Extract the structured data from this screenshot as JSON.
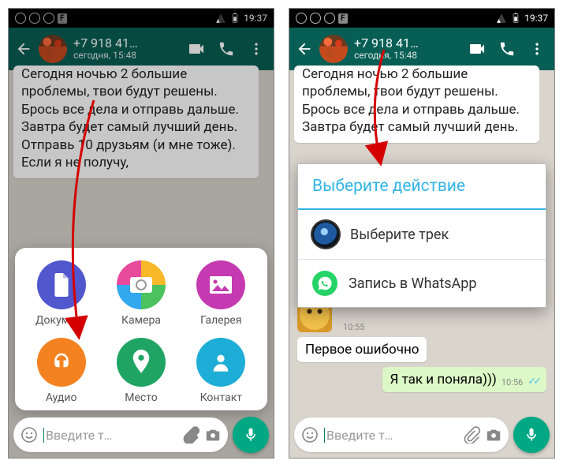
{
  "statusbar": {
    "time": "19:37"
  },
  "header": {
    "name": "+7 918 41…",
    "sub": "сегодня, 15:48"
  },
  "left": {
    "msg": "Сегодня ночью 2 большие проблемы, твои будут решены. Брось все дела и отправь дальше. Завтра будет самый лучший день. Отправь 10 друзьям (и мне тоже). Если я не получу,",
    "attach": {
      "doc": "Документ",
      "cam": "Камера",
      "gal": "Галерея",
      "aud": "Аудио",
      "loc": "Место",
      "con": "Контакт"
    }
  },
  "right": {
    "msg": "Сегодня ночью 2 большие проблемы, твои будут решены. Брось все дела и отправь дальше. Завтра будет самый лучший день.",
    "dialog": {
      "title": "Выберите действие",
      "opt1": "Выберите трек",
      "opt2": "Запись в WhatsApp"
    },
    "sticker_ts": "10:55",
    "in_msg": "Первое ошибочно",
    "out_msg": "Я так и поняла)))",
    "out_ts": "10:56"
  },
  "input": {
    "placeholder": "Введите т…"
  }
}
